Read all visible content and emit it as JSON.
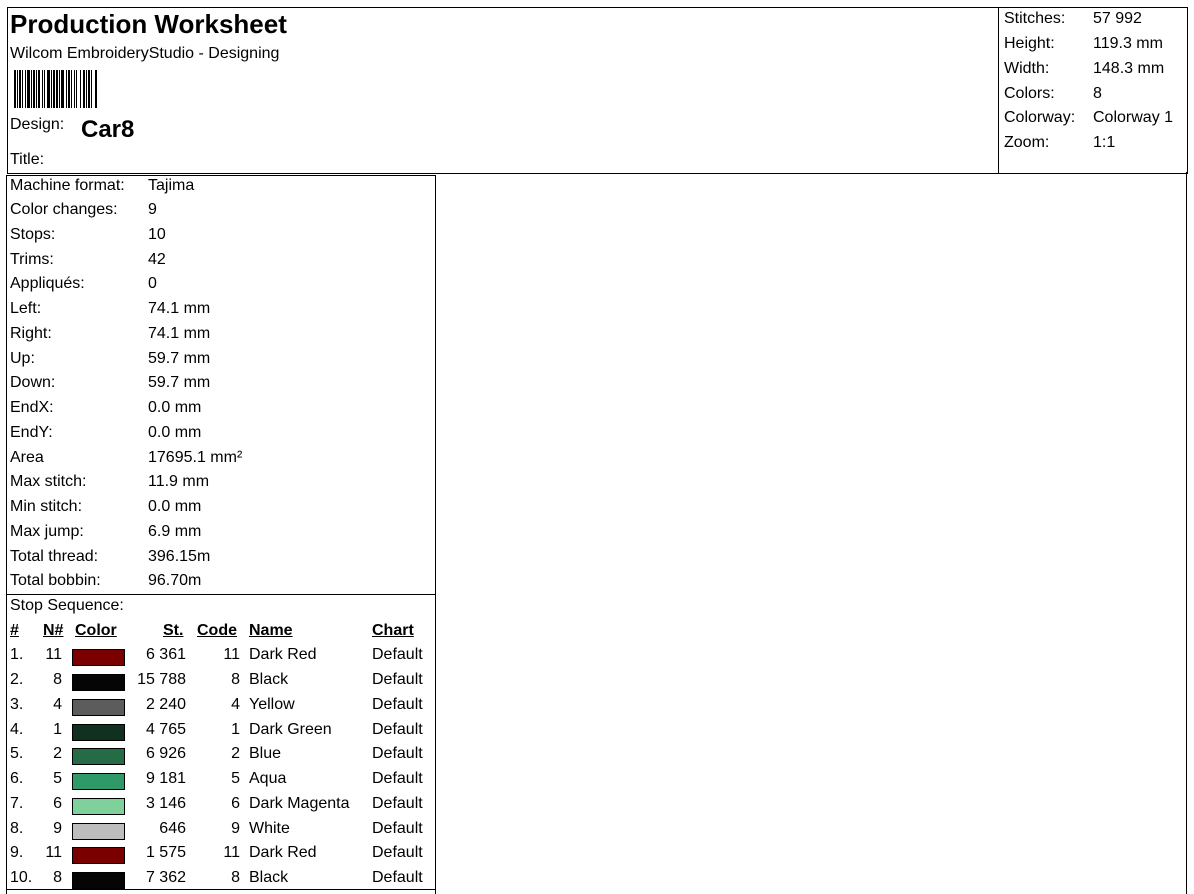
{
  "header": {
    "title": "Production Worksheet",
    "subtitle": "Wilcom EmbroideryStudio - Designing",
    "design_label": "Design:",
    "design_value": "Car8",
    "title_label": "Title:"
  },
  "stats": [
    {
      "label": "Stitches:",
      "value": "57 992"
    },
    {
      "label": "Height:",
      "value": "119.3 mm"
    },
    {
      "label": "Width:",
      "value": "148.3 mm"
    },
    {
      "label": "Colors:",
      "value": "8"
    },
    {
      "label": "Colorway:",
      "value": "Colorway 1"
    },
    {
      "label": "Zoom:",
      "value": "1:1"
    }
  ],
  "info": [
    {
      "label": "Machine format:",
      "value": "Tajima"
    },
    {
      "label": "Color changes:",
      "value": "9"
    },
    {
      "label": "Stops:",
      "value": "10"
    },
    {
      "label": "Trims:",
      "value": "42"
    },
    {
      "label": "Appliqués:",
      "value": "0"
    },
    {
      "label": "Left:",
      "value": "74.1 mm"
    },
    {
      "label": "Right:",
      "value": "74.1 mm"
    },
    {
      "label": "Up:",
      "value": "59.7 mm"
    },
    {
      "label": "Down:",
      "value": "59.7 mm"
    },
    {
      "label": "EndX:",
      "value": "0.0 mm"
    },
    {
      "label": "EndY:",
      "value": "0.0 mm"
    },
    {
      "label": "Area",
      "value": "17695.1 mm²"
    },
    {
      "label": "Max stitch:",
      "value": "11.9 mm"
    },
    {
      "label": "Min stitch:",
      "value": "0.0 mm"
    },
    {
      "label": "Max jump:",
      "value": "6.9 mm"
    },
    {
      "label": "Total thread:",
      "value": "396.15m"
    },
    {
      "label": "Total bobbin:",
      "value": "96.70m"
    }
  ],
  "sequence": {
    "title": "Stop Sequence:",
    "headers": {
      "num": "#",
      "n": "N#",
      "color": "Color",
      "st": "St.",
      "code": "Code",
      "name": "Name",
      "chart": "Chart"
    },
    "rows": [
      {
        "num": "1.",
        "n": "11",
        "color": "#7a0000",
        "st": "6 361",
        "code": "11",
        "name": "Dark Red",
        "chart": "Default"
      },
      {
        "num": "2.",
        "n": "8",
        "color": "#050505",
        "st": "15 788",
        "code": "8",
        "name": "Black",
        "chart": "Default"
      },
      {
        "num": "3.",
        "n": "4",
        "color": "#5c5c5c",
        "st": "2 240",
        "code": "4",
        "name": "Yellow",
        "chart": "Default"
      },
      {
        "num": "4.",
        "n": "1",
        "color": "#12301f",
        "st": "4 765",
        "code": "1",
        "name": "Dark Green",
        "chart": "Default"
      },
      {
        "num": "5.",
        "n": "2",
        "color": "#256b46",
        "st": "6 926",
        "code": "2",
        "name": "Blue",
        "chart": "Default"
      },
      {
        "num": "6.",
        "n": "5",
        "color": "#2f9a67",
        "st": "9 181",
        "code": "5",
        "name": "Aqua",
        "chart": "Default"
      },
      {
        "num": "7.",
        "n": "6",
        "color": "#7fd19c",
        "st": "3 146",
        "code": "6",
        "name": "Dark Magenta",
        "chart": "Default"
      },
      {
        "num": "8.",
        "n": "9",
        "color": "#bdbdbd",
        "st": "646",
        "code": "9",
        "name": "White",
        "chart": "Default"
      },
      {
        "num": "9.",
        "n": "11",
        "color": "#7a0000",
        "st": "1 575",
        "code": "11",
        "name": "Dark Red",
        "chart": "Default"
      },
      {
        "num": "10.",
        "n": "8",
        "color": "#050505",
        "st": "7 362",
        "code": "8",
        "name": "Black",
        "chart": "Default"
      }
    ]
  }
}
